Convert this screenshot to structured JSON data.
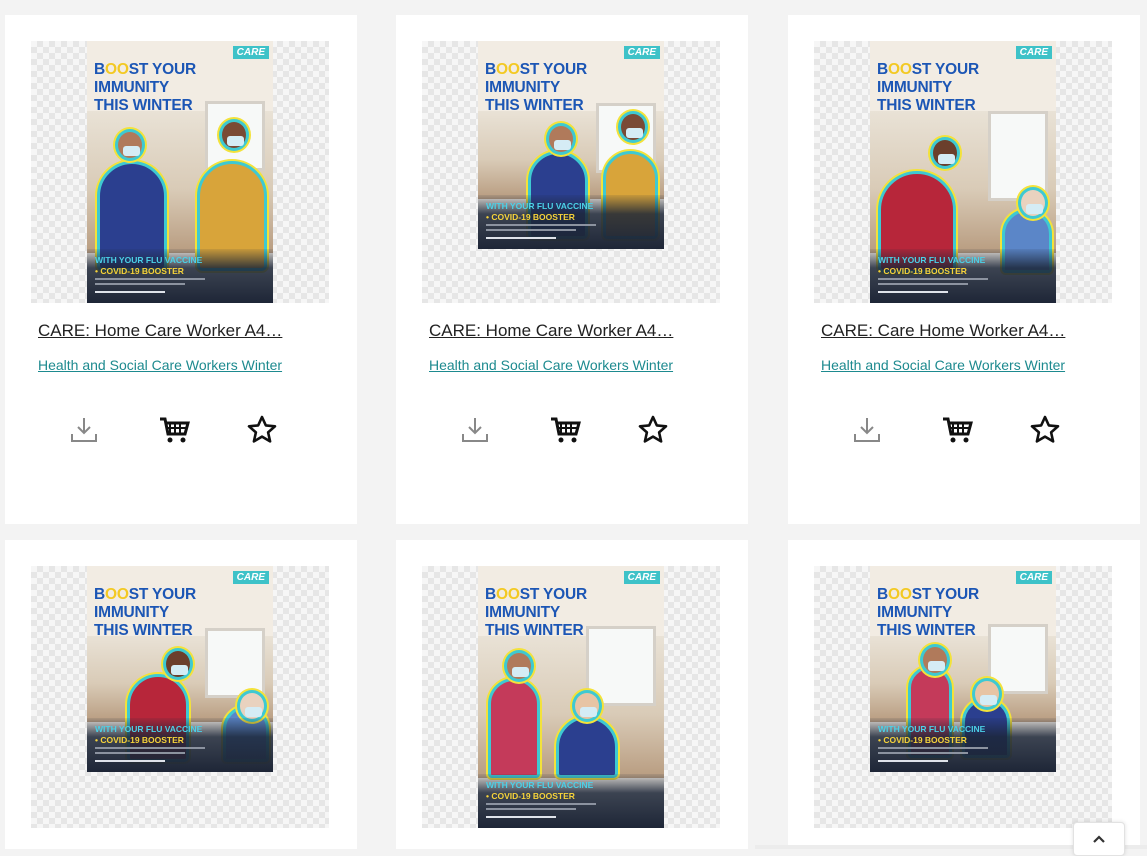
{
  "products": [
    {
      "title": "CARE: Home Care Worker A4…",
      "category": "Health and Social Care Workers Winter",
      "brand": "CARE",
      "headline": [
        "B",
        "OO",
        "ST YOUR",
        "IMMUNITY",
        "THIS WINTER"
      ],
      "band_line1": "WITH YOUR FLU VACCINE",
      "band_line2": "• COVID-19 BOOSTER"
    },
    {
      "title": "CARE: Home Care Worker A4…",
      "category": "Health and Social Care Workers Winter",
      "brand": "CARE",
      "headline": [
        "B",
        "OO",
        "ST YOUR",
        "IMMUNITY",
        "THIS WINTER"
      ],
      "band_line1": "WITH YOUR FLU VACCINE",
      "band_line2": "• COVID-19 BOOSTER"
    },
    {
      "title": "CARE: Care Home Worker A4…",
      "category": "Health and Social Care Workers Winter",
      "brand": "CARE",
      "headline": [
        "B",
        "OO",
        "ST YOUR",
        "IMMUNITY",
        "THIS WINTER"
      ],
      "band_line1": "WITH YOUR FLU VACCINE",
      "band_line2": "• COVID-19 BOOSTER"
    },
    {
      "title": "",
      "category": "",
      "brand": "CARE",
      "headline": [
        "B",
        "OO",
        "ST YOUR",
        "IMMUNITY",
        "THIS WINTER"
      ],
      "band_line1": "WITH YOUR FLU VACCINE",
      "band_line2": "• COVID-19 BOOSTER"
    },
    {
      "title": "",
      "category": "",
      "brand": "CARE",
      "headline": [
        "B",
        "OO",
        "ST YOUR",
        "IMMUNITY",
        "THIS WINTER"
      ],
      "band_line1": "WITH YOUR FLU VACCINE",
      "band_line2": "• COVID-19 BOOSTER"
    },
    {
      "title": "",
      "category": "",
      "brand": "CARE",
      "headline": [
        "B",
        "OO",
        "ST YOUR",
        "IMMUNITY",
        "THIS WINTER"
      ],
      "band_line1": "WITH YOUR FLU VACCINE",
      "band_line2": "• COVID-19 BOOSTER"
    }
  ],
  "actions": {
    "download_icon": "download-icon",
    "cart_icon": "shopping-cart-icon",
    "favourite_icon": "star-icon"
  },
  "scroll_top_icon": "chevron-up-icon",
  "colors": {
    "link": "#1d8a8f",
    "headline": "#1c56b5",
    "accent_yellow": "#f3c923",
    "outline_cyan": "#3ec9d2",
    "brand_badge": "#3ec2c8"
  }
}
